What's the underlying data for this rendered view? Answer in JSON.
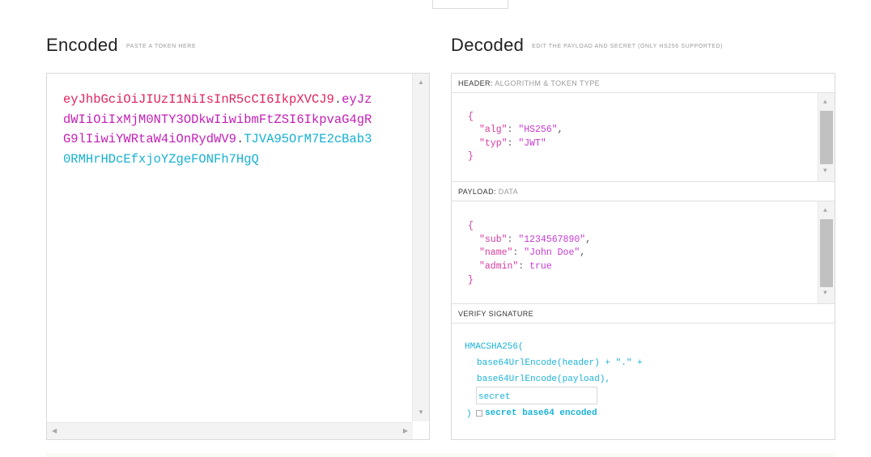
{
  "encoded": {
    "title": "Encoded",
    "subtitle": "PASTE A TOKEN HERE",
    "token_header": "eyJhbGciOiJIUzI1NiIsInR5cCI6IkpXVCJ9",
    "token_payload": "eyJzdWIiOiIxMjM0NTY3ODkwIiwibmFtZSI6IkpvaG4gRG9lIiwiYWRtaW4iOnRydWV9",
    "token_signature": "TJVA95OrM7E2cBab30RMHrHDcEfxjoYZgeFONFh7HgQ",
    "line1_head": "eyJhbGciOiJIUzI1NiIsInR5cCI6IkpXVCJ9",
    "line1_pay": "eyJz",
    "line2_pay": "dWIiOiIxMjM0NTY3ODkwIiwibmFtZSI6IkpvaG4gR",
    "line3_pay": "G9lIiwiYWRtaW4iOnRydWV9",
    "line3_sig": "TJVA95OrM7E2cBab3",
    "line4_sig": "0RMHrHDcEfxjoYZgeFONFh7HgQ",
    "dot": "."
  },
  "decoded": {
    "title": "Decoded",
    "subtitle": "EDIT THE PAYLOAD AND SECRET (ONLY HS256 SUPPORTED)",
    "header_section": {
      "label": "HEADER:",
      "sublabel": "ALGORITHM & TOKEN TYPE"
    },
    "header_json": {
      "open": "{",
      "alg_key": "\"alg\"",
      "alg_val": "\"HS256\"",
      "typ_key": "\"typ\"",
      "typ_val": "\"JWT\"",
      "close": "}"
    },
    "payload_section": {
      "label": "PAYLOAD:",
      "sublabel": "DATA"
    },
    "payload_json": {
      "open": "{",
      "sub_key": "\"sub\"",
      "sub_val": "\"1234567890\"",
      "name_key": "\"name\"",
      "name_val": "\"John Doe\"",
      "admin_key": "\"admin\"",
      "admin_val": "true",
      "close": "}"
    },
    "signature_section": {
      "label": "VERIFY SIGNATURE"
    },
    "signature": {
      "fn_open": "HMACSHA256(",
      "line_header": "base64UrlEncode(header) + \".\" +",
      "line_payload": "base64UrlEncode(payload),",
      "secret_placeholder": "secret",
      "fn_close": ")",
      "checkbox_label": "secret base64 encoded"
    }
  },
  "colors": {
    "header": "#e0245e",
    "payload": "#c41fb5",
    "signature": "#17b1d3"
  }
}
